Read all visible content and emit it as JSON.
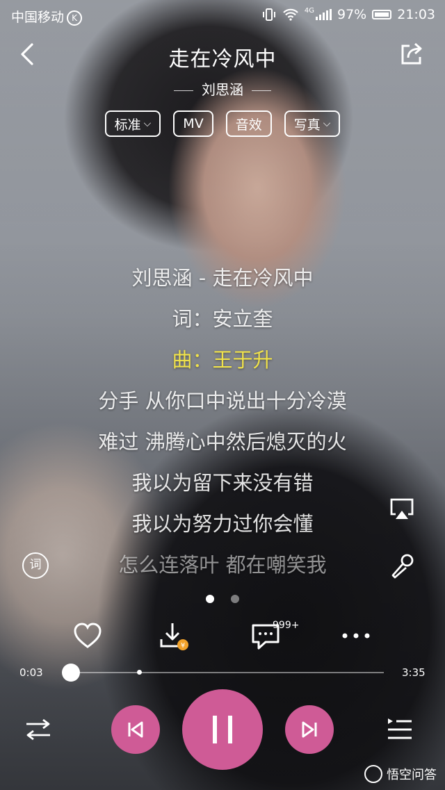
{
  "status_bar": {
    "carrier": "中国移动",
    "carrier_badge": "K",
    "network": "4G",
    "battery": "97%",
    "time": "21:03"
  },
  "header": {
    "title": "走在冷风中",
    "artist": "刘思涵"
  },
  "chips": [
    {
      "label": "标准",
      "has_dropdown": true
    },
    {
      "label": "MV",
      "has_dropdown": false
    },
    {
      "label": "音效",
      "has_dropdown": false
    },
    {
      "label": "写真",
      "has_dropdown": true
    }
  ],
  "lyrics": [
    {
      "text": "刘思涵 - 走在冷风中",
      "state": "dim"
    },
    {
      "text": "词：安立奎",
      "state": "dim"
    },
    {
      "text": "曲：王于升",
      "state": "active"
    },
    {
      "text": "分手 从你口中说出十分冷漠",
      "state": "dim"
    },
    {
      "text": "难过 沸腾心中然后熄灭的火",
      "state": "dim"
    },
    {
      "text": "我以为留下来没有错",
      "state": "dim"
    },
    {
      "text": "我以为努力过你会懂",
      "state": "dim"
    },
    {
      "text": "怎么连落叶 都在嘲笑我",
      "state": "fade"
    }
  ],
  "lyric_button_label": "词",
  "pager": {
    "pages": 2,
    "current": 1
  },
  "actions": {
    "comment_count": "999+"
  },
  "progress": {
    "elapsed": "0:03",
    "total": "3:35",
    "fraction": 0.014,
    "buffered_fraction": 0.23
  },
  "colors": {
    "accent": "#cf5b96",
    "active_lyric": "#f0e24a",
    "download_badge": "#f2a22a"
  },
  "icons": [
    "back-icon",
    "share-icon",
    "airplay-icon",
    "microphone-icon",
    "heart-icon",
    "download-icon",
    "comment-icon",
    "more-icon",
    "shuffle-icon",
    "previous-icon",
    "pause-icon",
    "next-icon",
    "playlist-icon"
  ],
  "watermark": "悟空问答"
}
